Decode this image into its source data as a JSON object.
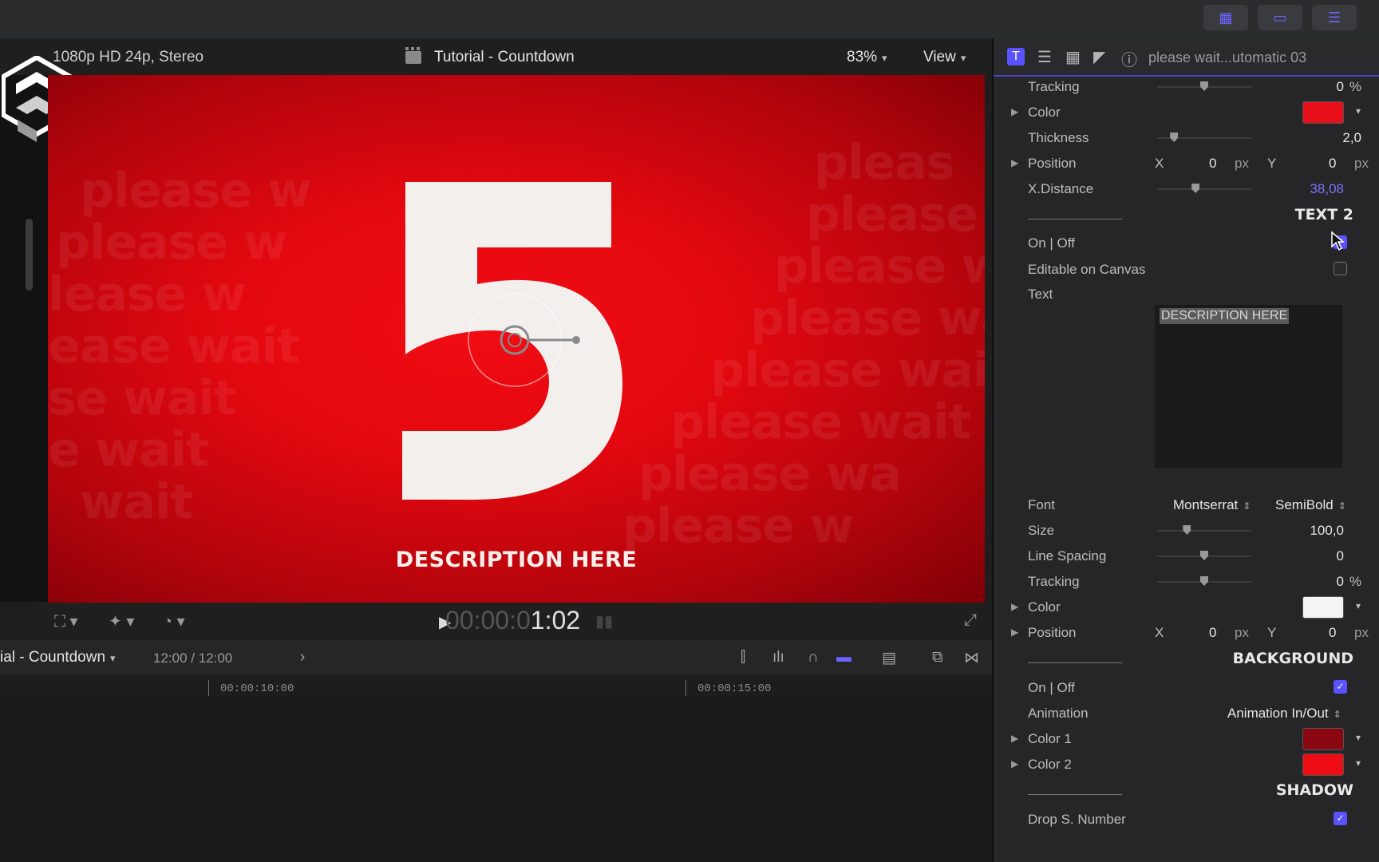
{
  "viewer": {
    "format": "1080p HD 24p, Stereo",
    "title": "Tutorial - Countdown",
    "zoom": "83%",
    "view": "View",
    "timecode_dim": "00:00:0",
    "timecode_lit": "1:02"
  },
  "canvas": {
    "number": "5",
    "description": "DESCRIPTION HERE",
    "bg_text": [
      "please w",
      "please w",
      "lease w",
      "ease wait",
      "se wait",
      "e wait",
      "wait",
      "pleas",
      "please",
      "please w",
      "please wa",
      "please wai",
      "please wait",
      "please wa",
      "please w"
    ]
  },
  "timeline": {
    "project": "ial - Countdown",
    "duration": "12:00 / 12:00",
    "ruler_1": "00:00:10:00",
    "ruler_2": "00:00:15:00"
  },
  "inspector": {
    "title": "please wait...utomatic 03",
    "rows": {
      "tracking1": {
        "label": "Tracking",
        "value": "0",
        "unit": "%",
        "level": 0.5
      },
      "color1": {
        "label": "Color",
        "swatch": "#e8101a"
      },
      "thickness": {
        "label": "Thickness",
        "value": "2,0",
        "level": 0.15
      },
      "position1": {
        "label": "Position",
        "x_label": "X",
        "x": "0",
        "y_label": "Y",
        "y": "0",
        "unit": "px"
      },
      "xdistance": {
        "label": "X.Distance",
        "value": "38,08",
        "level": 0.4
      },
      "text2": {
        "title": "TEXT 2"
      },
      "onoff1": {
        "label": "On | Off",
        "checked": true
      },
      "editable": {
        "label": "Editable on Canvas",
        "checked": false
      },
      "text": {
        "label": "Text",
        "value": "DESCRIPTION HERE"
      },
      "font": {
        "label": "Font",
        "family": "Montserrat",
        "weight": "SemiBold"
      },
      "size": {
        "label": "Size",
        "value": "100,0",
        "level": 0.3
      },
      "linespacing": {
        "label": "Line Spacing",
        "value": "0",
        "level": 0.5
      },
      "tracking2": {
        "label": "Tracking",
        "value": "0",
        "unit": "%",
        "level": 0.5
      },
      "color2": {
        "label": "Color",
        "swatch": "#f4f4f4"
      },
      "position2": {
        "label": "Position",
        "x_label": "X",
        "x": "0",
        "y_label": "Y",
        "y": "0",
        "unit": "px"
      },
      "background": {
        "title": "BACKGROUND"
      },
      "onoff2": {
        "label": "On | Off",
        "checked": true
      },
      "animation": {
        "label": "Animation",
        "value": "Animation In/Out"
      },
      "bgcolor1": {
        "label": "Color 1",
        "swatch": "#8a0610"
      },
      "bgcolor2": {
        "label": "Color 2",
        "swatch": "#ee0d15"
      },
      "shadow": {
        "title": "SHADOW"
      },
      "drops": {
        "label": "Drop S. Number",
        "checked": true
      }
    }
  },
  "colors": {
    "accent": "#5a52ff",
    "canvas_red": "#e3080f"
  }
}
